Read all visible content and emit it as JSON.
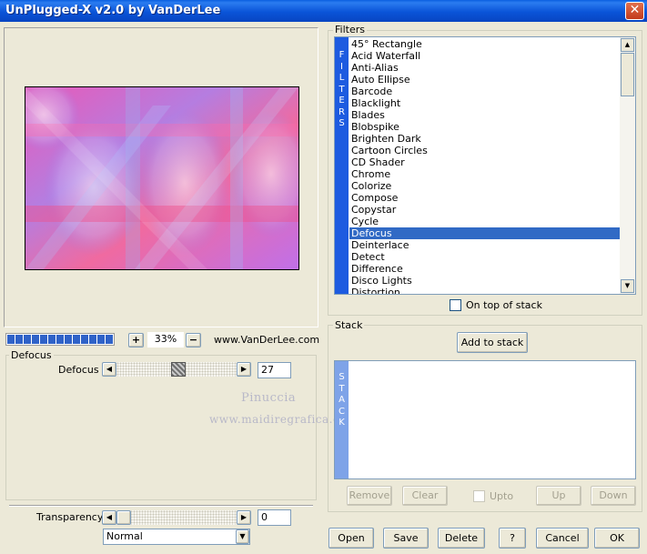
{
  "window": {
    "title": "UnPlugged-X v2.0 by VanDerLee",
    "close_label": "✕"
  },
  "zoom": {
    "plus": "+",
    "minus": "−",
    "value": "33%",
    "progress": 1.0,
    "link": "www.VanDerLee.com"
  },
  "filters": {
    "group_label": "Filters",
    "strip_text": "FILTERS",
    "items": [
      "45° Rectangle",
      "Acid Waterfall",
      "Anti-Alias",
      "Auto Ellipse",
      "Barcode",
      "Blacklight",
      "Blades",
      "Blobspike",
      "Brighten Dark",
      "Cartoon Circles",
      "CD Shader",
      "Chrome",
      "Colorize",
      "Compose",
      "Copystar",
      "Cycle",
      "Defocus",
      "Deinterlace",
      "Detect",
      "Difference",
      "Disco Lights",
      "Distortion"
    ],
    "selected": "Defocus",
    "on_top_label": "On top of stack"
  },
  "stack": {
    "group_label": "Stack",
    "add_label": "Add to stack",
    "strip_text": "STACK",
    "remove_label": "Remove",
    "clear_label": "Clear",
    "upto_label": "Upto",
    "up_label": "Up",
    "down_label": "Down"
  },
  "params": {
    "group_label": "Defocus",
    "defocus_label": "Defocus",
    "defocus_value": "27",
    "defocus_level": 0.52,
    "transparency_label": "Transparency",
    "transparency_value": "0",
    "blend_mode": "Normal"
  },
  "watermark": {
    "line1": "Pinuccia",
    "line2": "www.maidiregrafica.eu"
  },
  "footer": {
    "open": "Open",
    "save": "Save",
    "delete": "Delete",
    "help": "?",
    "cancel": "Cancel",
    "ok": "OK"
  },
  "colors": {
    "title_bar": "#0a54d8",
    "selection": "#316ac5",
    "filters_strip": "#1d5be0",
    "stack_strip": "#7ea3e8"
  }
}
